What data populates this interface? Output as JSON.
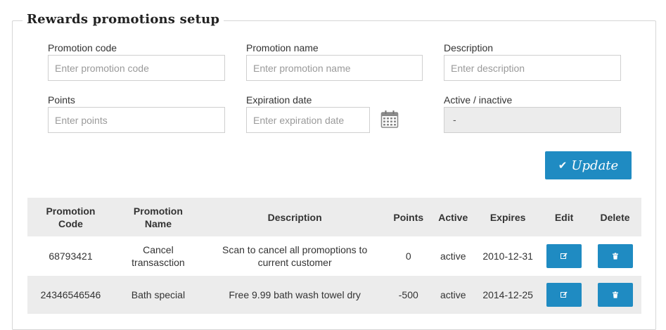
{
  "form": {
    "legend": "Rewards promotions setup",
    "promo_code": {
      "label": "Promotion code",
      "placeholder": "Enter promotion code"
    },
    "promo_name": {
      "label": "Promotion name",
      "placeholder": "Enter promotion name"
    },
    "description": {
      "label": "Description",
      "placeholder": "Enter description"
    },
    "points": {
      "label": "Points",
      "placeholder": "Enter points"
    },
    "expiration": {
      "label": "Expiration date",
      "placeholder": "Enter expiration date"
    },
    "active": {
      "label": "Active / inactive",
      "value": "-"
    },
    "update_label": "Update"
  },
  "table": {
    "headers": [
      "Promotion Code",
      "Promotion Name",
      "Description",
      "Points",
      "Active",
      "Expires",
      "Edit",
      "Delete"
    ],
    "rows": [
      {
        "code": "68793421",
        "name": "Cancel transasction",
        "description": "Scan to cancel all promoptions to current customer",
        "points": "0",
        "active": "active",
        "expires": "2010-12-31"
      },
      {
        "code": "24346546546",
        "name": "Bath special",
        "description": "Free 9.99 bath wash towel dry",
        "points": "-500",
        "active": "active",
        "expires": "2014-12-25"
      }
    ]
  },
  "colors": {
    "accent": "#1f8bc2",
    "header_bg": "#ececec",
    "border": "#cfcfcf"
  },
  "icons": {
    "calendar": "calendar-icon",
    "check": "check-icon",
    "edit": "edit-icon",
    "delete": "trash-icon"
  }
}
